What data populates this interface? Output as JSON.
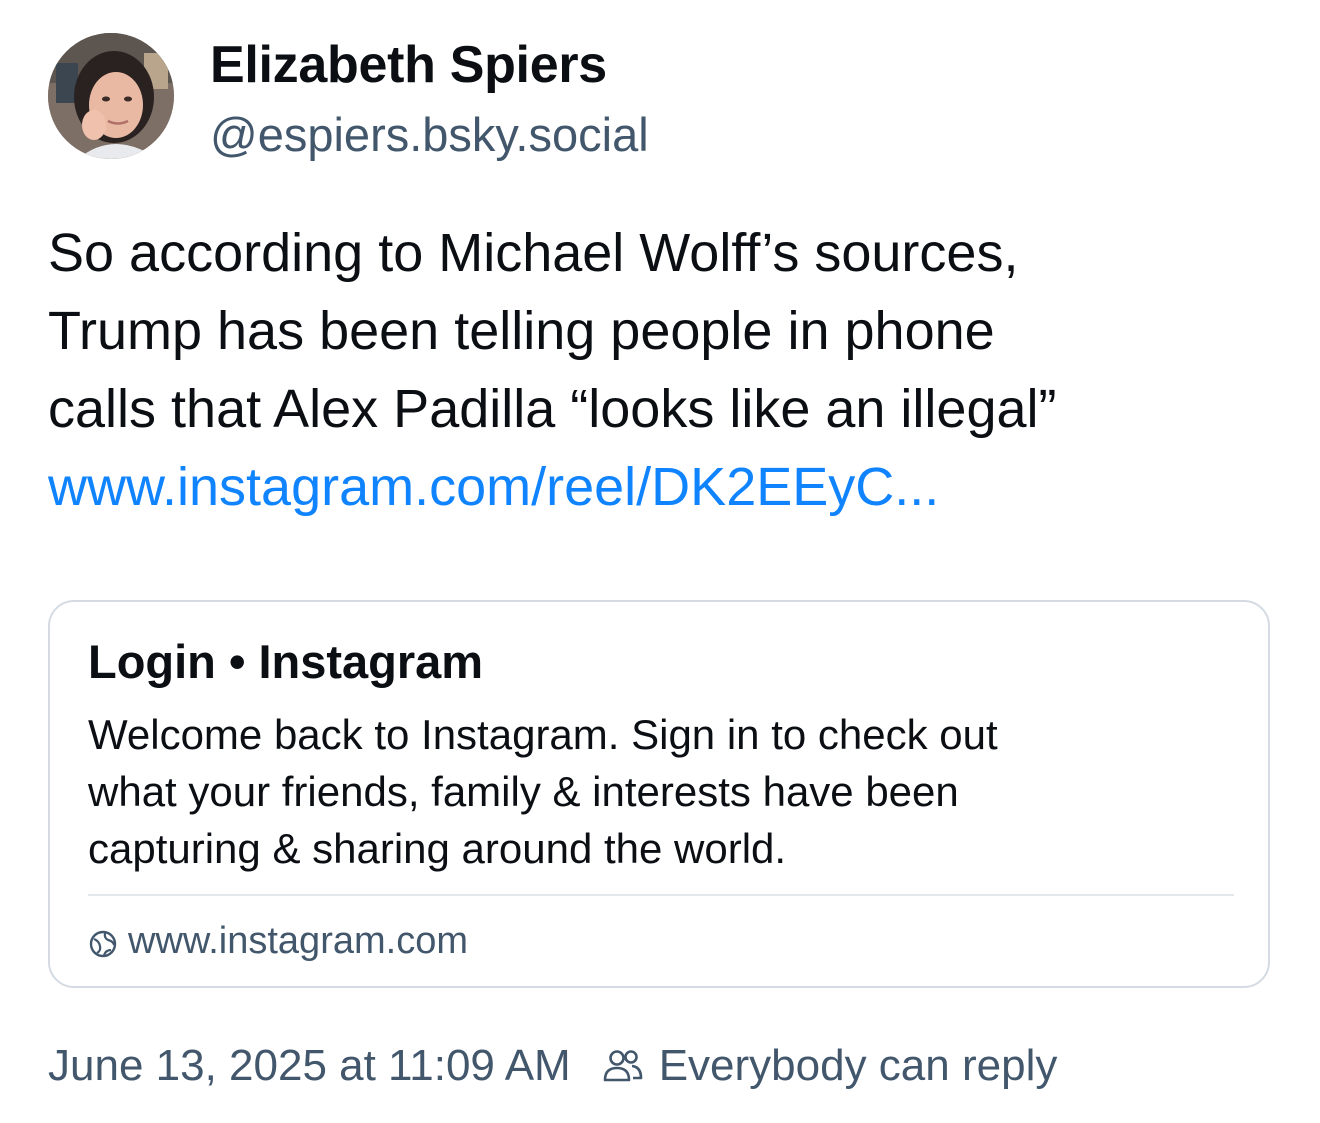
{
  "author": {
    "display_name": "Elizabeth Spiers",
    "handle": "@espiers.bsky.social",
    "avatar_icon": "profile-photo"
  },
  "post": {
    "text_lines": [
      "So according to Michael Wolff’s sources,",
      "Trump has been telling people in phone",
      "calls that Alex Padilla “looks like an illegal”"
    ],
    "link_text": "www.instagram.com/reel/DK2EEyC..."
  },
  "embed": {
    "title": "Login • Instagram",
    "description_lines": [
      "Welcome back to Instagram. Sign in to check out",
      "what your friends, family & interests have been",
      "capturing & sharing around the world."
    ],
    "domain": "www.instagram.com",
    "domain_icon": "globe-icon"
  },
  "meta": {
    "timestamp": "June 13, 2025 at 11:09 AM",
    "reply_setting": "Everybody can reply",
    "reply_icon": "people-icon"
  },
  "colors": {
    "link": "#1083fe",
    "secondary_text": "#42576c",
    "primary_text": "#0b0f14",
    "border": "#d4dbe2"
  }
}
